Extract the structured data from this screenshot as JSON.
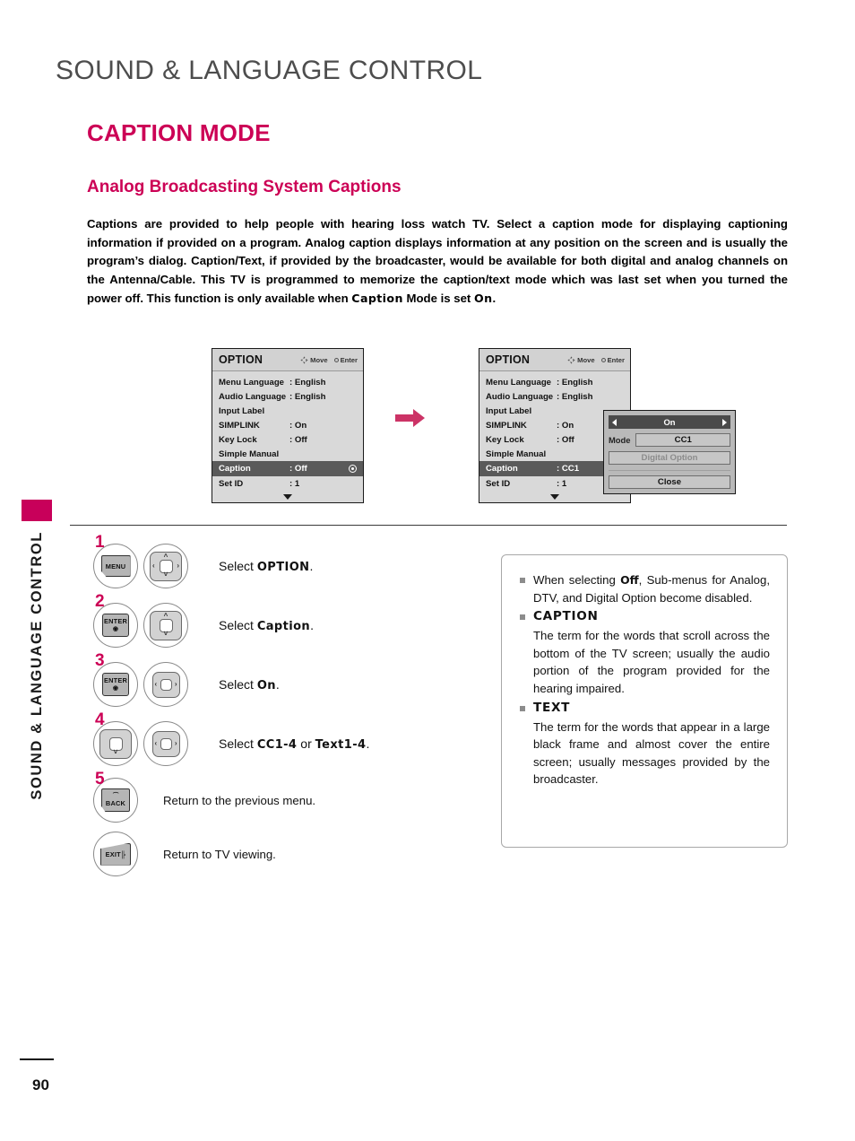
{
  "header": {
    "page_title": "SOUND & LANGUAGE CONTROL",
    "section_title": "CAPTION MODE",
    "subsection_title": "Analog Broadcasting System Captions"
  },
  "sidebar": {
    "vertical_label": "SOUND & LANGUAGE CONTROL"
  },
  "intro": {
    "part1": "Captions are provided to help people with hearing loss watch TV. Select a caption mode for displaying captioning information if provided on a program. Analog caption displays information at any position on the screen and is usually the program’s dialog. Caption/Text, if provided by the broadcaster, would be available for both digital and analog channels on the Antenna/Cable. This TV is programmed to memorize the caption/text mode which was last set when you turned the power off. This function is only available when ",
    "emphasis1": "Caption",
    "part2": " Mode is set ",
    "emphasis2": "On",
    "part3": "."
  },
  "osd": {
    "title": "OPTION",
    "hint_move": "Move",
    "hint_enter": "Enter",
    "left": {
      "rows": [
        {
          "label": "Menu Language",
          "value": ": English"
        },
        {
          "label": "Audio Language",
          "value": ": English"
        },
        {
          "label": "Input Label",
          "value": ""
        },
        {
          "label": "SIMPLINK",
          "value": ": On"
        },
        {
          "label": "Key Lock",
          "value": ": Off"
        },
        {
          "label": "Simple Manual",
          "value": ""
        },
        {
          "label": "Caption",
          "value": ": Off"
        },
        {
          "label": "Set ID",
          "value": ": 1"
        }
      ]
    },
    "right": {
      "rows": [
        {
          "label": "Menu Language",
          "value": ": English"
        },
        {
          "label": "Audio Language",
          "value": ": English"
        },
        {
          "label": "Input Label",
          "value": ""
        },
        {
          "label": "SIMPLINK",
          "value": ": On"
        },
        {
          "label": "Key Lock",
          "value": ": Off"
        },
        {
          "label": "Simple Manual",
          "value": ""
        },
        {
          "label": "Caption",
          "value": ": CC1"
        },
        {
          "label": "Set ID",
          "value": ": 1"
        }
      ]
    },
    "submenu": {
      "onoff_value": "On",
      "mode_label": "Mode",
      "mode_value": "CC1",
      "digital_option_label": "Digital Option",
      "close_label": "Close"
    }
  },
  "steps": [
    {
      "number": "1",
      "key1": "MENU",
      "text_prefix": "Select ",
      "text_bold": "OPTION",
      "text_suffix": "."
    },
    {
      "number": "2",
      "key1": "ENTER",
      "key1_sub": "◉",
      "text_prefix": "Select ",
      "text_bold": "Caption",
      "text_suffix": "."
    },
    {
      "number": "3",
      "key1": "ENTER",
      "key1_sub": "◉",
      "text_prefix": "Select ",
      "text_bold": "On",
      "text_suffix": "."
    },
    {
      "number": "4",
      "text_prefix": "Select ",
      "text_bold": "CC1-4",
      "text_mid": " or ",
      "text_bold2": "Text1-4",
      "text_suffix": "."
    },
    {
      "number": "5",
      "key1": "BACK",
      "text": "Return to the previous menu."
    },
    {
      "number": "",
      "key1": "EXIT",
      "text": "Return to TV viewing."
    }
  ],
  "note": {
    "item1_prefix": "When selecting ",
    "item1_bold": "Off",
    "item1_suffix": ", Sub-menus for Analog, DTV, and Digital Option become disabled.",
    "item2_head": "CAPTION",
    "item2_body": "The term for the words that scroll across the bottom of the TV screen; usually the audio portion of the program provided for the hearing impaired.",
    "item3_head": "TEXT",
    "item3_body": "The term for the words that appear in a large black frame and almost cover the entire screen; usually messages provided by the broadcaster."
  },
  "footer": {
    "page_number": "90"
  },
  "colors": {
    "accent_magenta": "#cc0055",
    "title_gray": "#4d4d4d",
    "osd_background": "#d9d9d9",
    "osd_selected": "#5a5a5a"
  }
}
